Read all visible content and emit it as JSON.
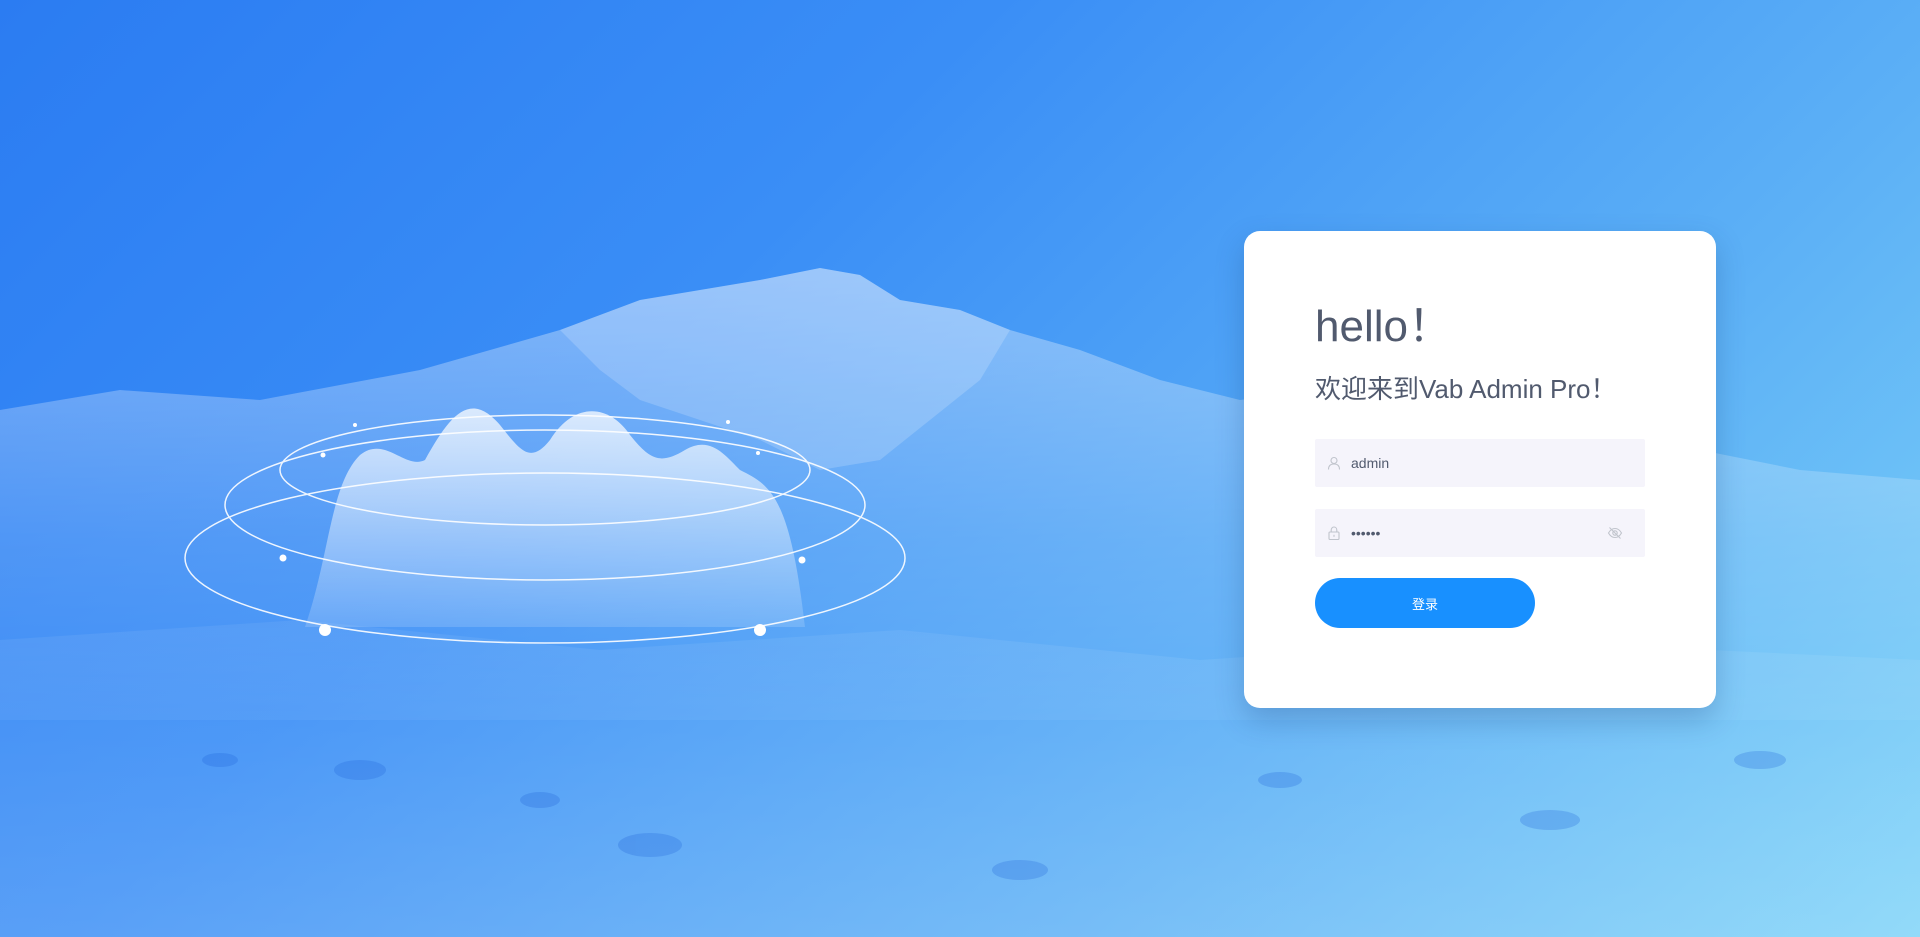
{
  "login": {
    "title": "hello！",
    "welcome": "欢迎来到Vab Admin Pro！",
    "username": {
      "value": "admin",
      "icon": "user-icon"
    },
    "password": {
      "value": "123456",
      "icon": "lock-icon",
      "toggle_icon": "eye-off-icon"
    },
    "submit_label": "登录"
  },
  "colors": {
    "primary": "#1890ff",
    "text": "#515a6e",
    "input_bg": "#f5f4fb",
    "background_start": "#2b7cf2",
    "background_end": "#7ed3f8"
  }
}
